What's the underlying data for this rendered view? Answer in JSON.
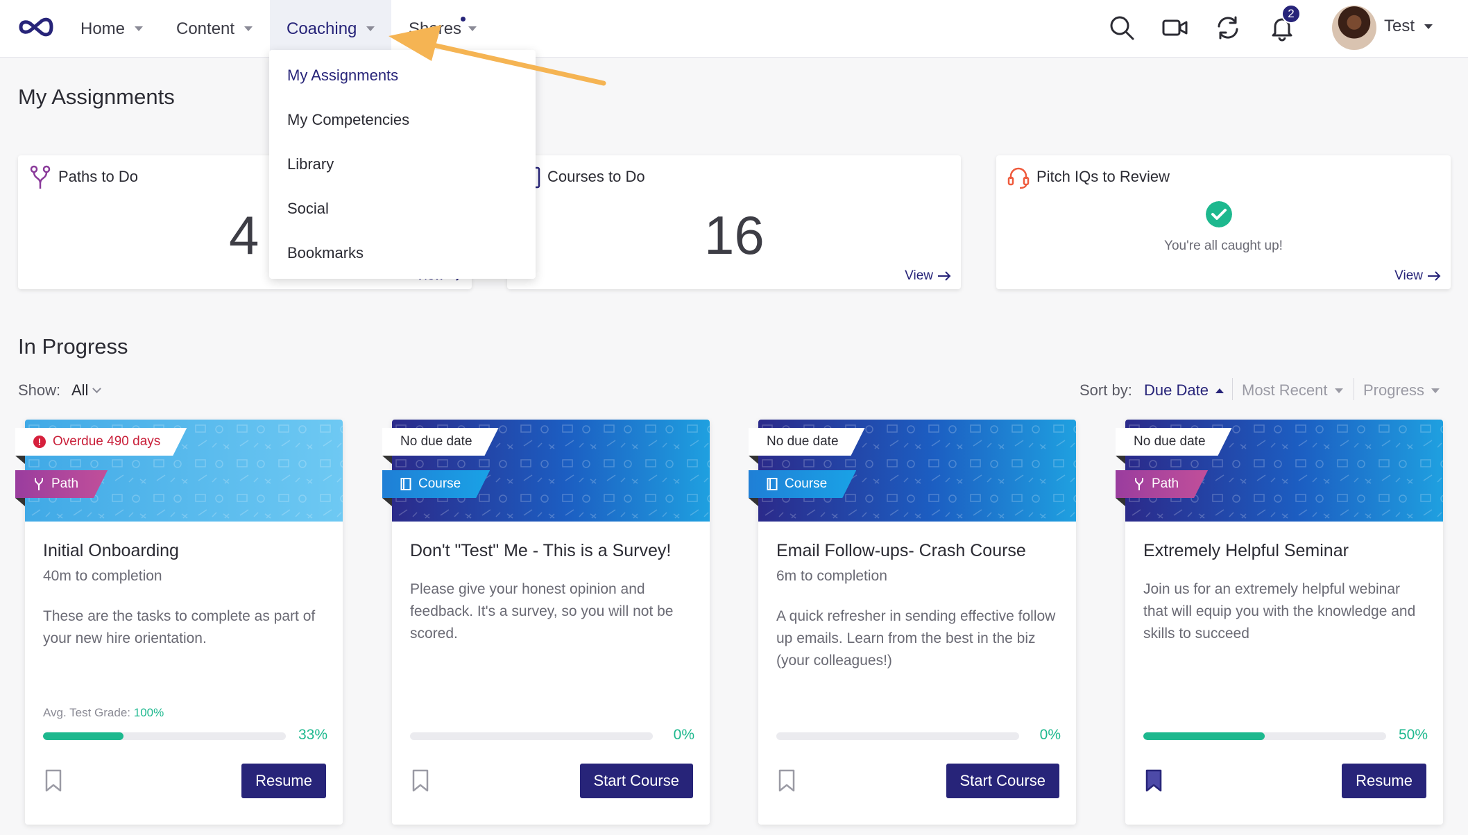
{
  "nav": {
    "items": [
      {
        "label": "Home"
      },
      {
        "label": "Content"
      },
      {
        "label": "Coaching"
      },
      {
        "label": "Shares"
      }
    ],
    "user_name": "Test",
    "notification_count": "2"
  },
  "dropdown": {
    "items": [
      {
        "label": "My Assignments"
      },
      {
        "label": "My Competencies"
      },
      {
        "label": "Library"
      },
      {
        "label": "Social"
      },
      {
        "label": "Bookmarks"
      }
    ]
  },
  "page": {
    "title": "My Assignments",
    "in_progress_title": "In Progress"
  },
  "summary": {
    "paths": {
      "title": "Paths to Do",
      "count": "4",
      "view": "View"
    },
    "courses": {
      "title": "Courses to Do",
      "count": "16",
      "view": "View"
    },
    "pitch": {
      "title": "Pitch IQs to Review",
      "message": "You're all caught up!",
      "view": "View"
    }
  },
  "filters": {
    "show_label": "Show:",
    "show_value": "All",
    "sort_label": "Sort by:",
    "sort_options": [
      {
        "label": "Due Date"
      },
      {
        "label": "Most Recent"
      },
      {
        "label": "Progress"
      }
    ]
  },
  "cards": [
    {
      "due": "Overdue 490 days",
      "type": "Path",
      "title": "Initial Onboarding",
      "subtitle": "40m to completion",
      "description": "These are the tasks to complete as part of your new hire orientation.",
      "grade_label": "Avg. Test Grade:",
      "grade_value": "100%",
      "progress": 33,
      "progress_label": "33%",
      "bookmarked": false,
      "action": "Resume"
    },
    {
      "due": "No due date",
      "type": "Course",
      "title": "Don't \"Test\" Me - This is a Survey!",
      "subtitle": "",
      "description": "Please give your honest opinion and feedback. It's a survey, so you will not be scored.",
      "progress": 0,
      "progress_label": "0%",
      "bookmarked": false,
      "action": "Start Course"
    },
    {
      "due": "No due date",
      "type": "Course",
      "title": "Email Follow-ups- Crash Course",
      "subtitle": "6m to completion",
      "description": "A quick refresher in sending effective follow up emails. Learn from the best in the biz (your colleagues!)",
      "progress": 0,
      "progress_label": "0%",
      "bookmarked": false,
      "action": "Start Course"
    },
    {
      "due": "No due date",
      "type": "Path",
      "title": "Extremely Helpful Seminar",
      "subtitle": "",
      "description": "Join us for an extremely helpful webinar that will equip you with the knowledge and skills to succeed",
      "progress": 50,
      "progress_label": "50%",
      "bookmarked": true,
      "action": "Resume"
    }
  ],
  "colors": {
    "brand": "#272479",
    "success": "#1db88e",
    "danger": "#d6203c",
    "arrow": "#f5b453"
  }
}
